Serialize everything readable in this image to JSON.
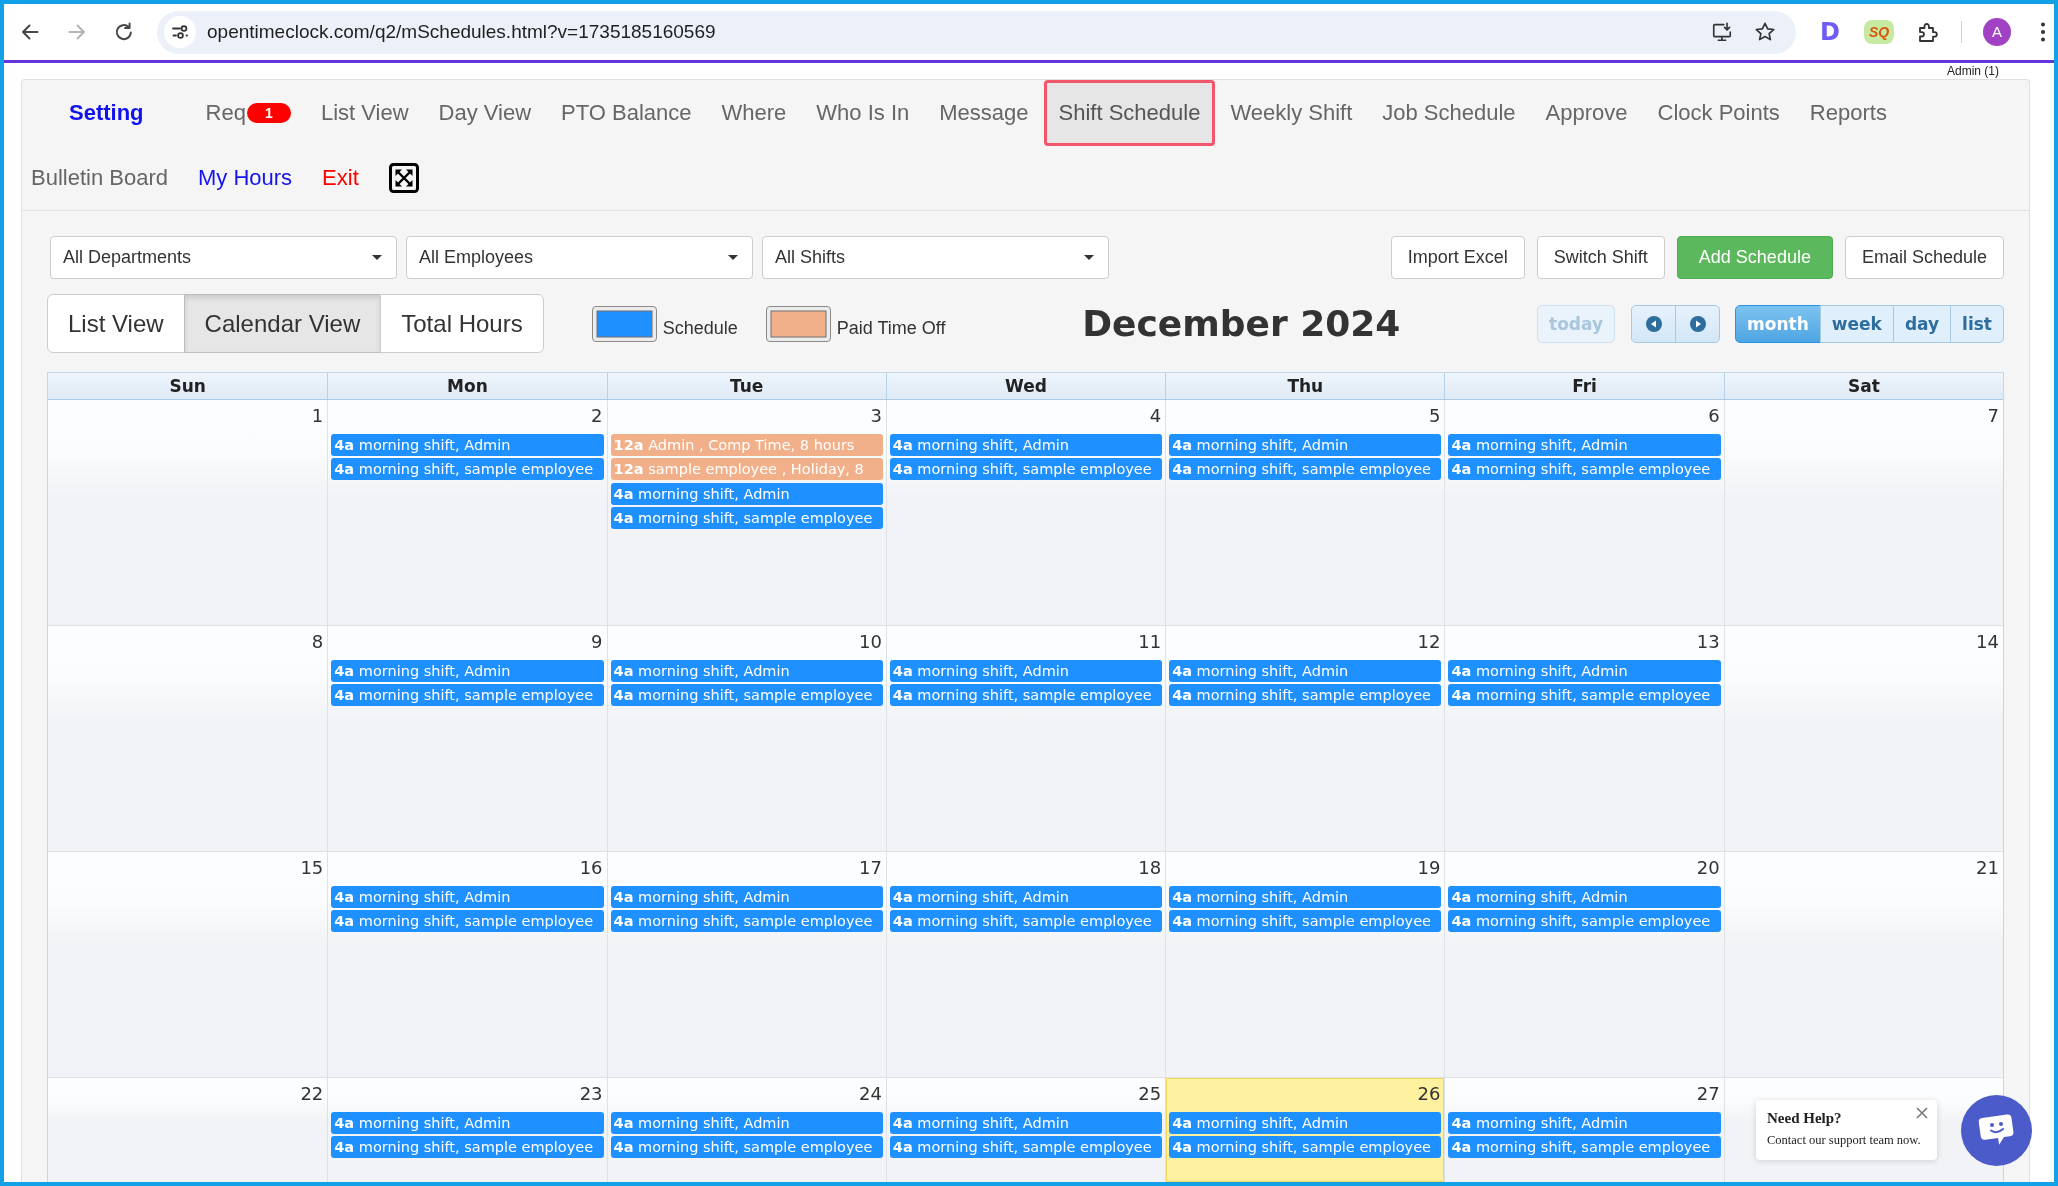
{
  "browser": {
    "nav_buttons": [
      {
        "kind": "back",
        "disabled": false
      },
      {
        "kind": "forward",
        "disabled": true
      },
      {
        "kind": "reload",
        "disabled": false
      }
    ],
    "url": "opentimeclock.com/q2/mSchedules.html?v=1735185160569",
    "extensions": [
      {
        "kind": "letter",
        "label": "D"
      },
      {
        "kind": "badge",
        "label": "SQ"
      }
    ],
    "profile_initial": "A"
  },
  "user_label": "Admin (1)",
  "nav_rows": [
    {
      "items": [
        {
          "label": "Setting",
          "kind": "primary",
          "selected": false
        },
        {
          "label": "Req",
          "kind": "plain",
          "badge": "1",
          "selected": false
        },
        {
          "label": "List View",
          "kind": "plain",
          "selected": false
        },
        {
          "label": "Day View",
          "kind": "plain",
          "selected": false
        },
        {
          "label": "PTO Balance",
          "kind": "plain",
          "selected": false
        },
        {
          "label": "Where",
          "kind": "plain",
          "selected": false
        },
        {
          "label": "Who Is In",
          "kind": "plain",
          "selected": false
        },
        {
          "label": "Message",
          "kind": "plain",
          "selected": false
        },
        {
          "label": "Shift Schedule",
          "kind": "plain",
          "selected": true
        },
        {
          "label": "Weekly Shift",
          "kind": "plain",
          "selected": false
        },
        {
          "label": "Job Schedule",
          "kind": "plain",
          "selected": false
        },
        {
          "label": "Approve",
          "kind": "plain",
          "selected": false
        },
        {
          "label": "Clock Points",
          "kind": "plain",
          "selected": false
        },
        {
          "label": "Reports",
          "kind": "plain",
          "selected": false
        }
      ]
    },
    {
      "items": [
        {
          "label": "Bulletin Board",
          "kind": "plain",
          "selected": false
        },
        {
          "label": "My Hours",
          "kind": "link",
          "selected": false
        },
        {
          "label": "Exit",
          "kind": "danger",
          "selected": false
        },
        {
          "kind": "fullscreen",
          "selected": false
        }
      ]
    }
  ],
  "filters": [
    {
      "value": "All Departments"
    },
    {
      "value": "All Employees"
    },
    {
      "value": "All Shifts"
    }
  ],
  "actions": [
    {
      "label": "Import Excel",
      "kind": "default"
    },
    {
      "label": "Switch Shift",
      "kind": "default"
    },
    {
      "label": "Add Schedule",
      "kind": "success"
    },
    {
      "label": "Email Schedule",
      "kind": "default"
    }
  ],
  "view_toggle": [
    {
      "label": "List View",
      "selected": false
    },
    {
      "label": "Calendar View",
      "selected": true
    },
    {
      "label": "Total Hours",
      "selected": false
    }
  ],
  "legend": [
    {
      "label": "Schedule",
      "color": "#1e90ff"
    },
    {
      "label": "Paid Time Off",
      "color": "#f2b08a"
    }
  ],
  "calendar": {
    "title": "December 2024",
    "today_button": {
      "label": "today",
      "disabled": true
    },
    "views": [
      {
        "label": "month",
        "selected": true
      },
      {
        "label": "week",
        "selected": false
      },
      {
        "label": "day",
        "selected": false
      },
      {
        "label": "list",
        "selected": false
      }
    ],
    "weekdays": [
      "Sun",
      "Mon",
      "Tue",
      "Wed",
      "Thu",
      "Fri",
      "Sat"
    ],
    "weeks": [
      {
        "days": [
          {
            "day": "1",
            "today": false
          },
          {
            "day": "2",
            "today": false,
            "events": [
              {
                "text": "**4a** morning shift, Admin",
                "kind": "schedule"
              },
              {
                "text": "**4a** morning shift, sample employee",
                "kind": "schedule"
              }
            ]
          },
          {
            "day": "3",
            "today": false,
            "events": [
              {
                "text": "**12a** Admin , Comp Time, 8 hours",
                "kind": "pto"
              },
              {
                "text": "**12a** sample employee , Holiday, 8",
                "kind": "pto"
              },
              {
                "text": "**4a** morning shift, Admin",
                "kind": "schedule"
              },
              {
                "text": "**4a** morning shift, sample employee",
                "kind": "schedule"
              }
            ]
          },
          {
            "day": "4",
            "today": false,
            "events": [
              {
                "text": "**4a** morning shift, Admin",
                "kind": "schedule"
              },
              {
                "text": "**4a** morning shift, sample employee",
                "kind": "schedule"
              }
            ]
          },
          {
            "day": "5",
            "today": false,
            "events": [
              {
                "text": "**4a** morning shift, Admin",
                "kind": "schedule"
              },
              {
                "text": "**4a** morning shift, sample employee",
                "kind": "schedule"
              }
            ]
          },
          {
            "day": "6",
            "today": false,
            "events": [
              {
                "text": "**4a** morning shift, Admin",
                "kind": "schedule"
              },
              {
                "text": "**4a** morning shift, sample employee",
                "kind": "schedule"
              }
            ]
          },
          {
            "day": "7",
            "today": false
          }
        ]
      },
      {
        "days": [
          {
            "day": "8",
            "today": false
          },
          {
            "day": "9",
            "today": false,
            "events": [
              {
                "text": "**4a** morning shift, Admin",
                "kind": "schedule"
              },
              {
                "text": "**4a** morning shift, sample employee",
                "kind": "schedule"
              }
            ]
          },
          {
            "day": "10",
            "today": false,
            "events": [
              {
                "text": "**4a** morning shift, Admin",
                "kind": "schedule"
              },
              {
                "text": "**4a** morning shift, sample employee",
                "kind": "schedule"
              }
            ]
          },
          {
            "day": "11",
            "today": false,
            "events": [
              {
                "text": "**4a** morning shift, Admin",
                "kind": "schedule"
              },
              {
                "text": "**4a** morning shift, sample employee",
                "kind": "schedule"
              }
            ]
          },
          {
            "day": "12",
            "today": false,
            "events": [
              {
                "text": "**4a** morning shift, Admin",
                "kind": "schedule"
              },
              {
                "text": "**4a** morning shift, sample employee",
                "kind": "schedule"
              }
            ]
          },
          {
            "day": "13",
            "today": false,
            "events": [
              {
                "text": "**4a** morning shift, Admin",
                "kind": "schedule"
              },
              {
                "text": "**4a** morning shift, sample employee",
                "kind": "schedule"
              }
            ]
          },
          {
            "day": "14",
            "today": false
          }
        ]
      },
      {
        "days": [
          {
            "day": "15",
            "today": false
          },
          {
            "day": "16",
            "today": false,
            "events": [
              {
                "text": "**4a** morning shift, Admin",
                "kind": "schedule"
              },
              {
                "text": "**4a** morning shift, sample employee",
                "kind": "schedule"
              }
            ]
          },
          {
            "day": "17",
            "today": false,
            "events": [
              {
                "text": "**4a** morning shift, Admin",
                "kind": "schedule"
              },
              {
                "text": "**4a** morning shift, sample employee",
                "kind": "schedule"
              }
            ]
          },
          {
            "day": "18",
            "today": false,
            "events": [
              {
                "text": "**4a** morning shift, Admin",
                "kind": "schedule"
              },
              {
                "text": "**4a** morning shift, sample employee",
                "kind": "schedule"
              }
            ]
          },
          {
            "day": "19",
            "today": false,
            "events": [
              {
                "text": "**4a** morning shift, Admin",
                "kind": "schedule"
              },
              {
                "text": "**4a** morning shift, sample employee",
                "kind": "schedule"
              }
            ]
          },
          {
            "day": "20",
            "today": false,
            "events": [
              {
                "text": "**4a** morning shift, Admin",
                "kind": "schedule"
              },
              {
                "text": "**4a** morning shift, sample employee",
                "kind": "schedule"
              }
            ]
          },
          {
            "day": "21",
            "today": false
          }
        ]
      },
      {
        "days": [
          {
            "day": "22",
            "today": false
          },
          {
            "day": "23",
            "today": false,
            "events": [
              {
                "text": "**4a** morning shift, Admin",
                "kind": "schedule"
              },
              {
                "text": "**4a** morning shift, sample employee",
                "kind": "schedule"
              }
            ]
          },
          {
            "day": "24",
            "today": false,
            "events": [
              {
                "text": "**4a** morning shift, Admin",
                "kind": "schedule"
              },
              {
                "text": "**4a** morning shift, sample employee",
                "kind": "schedule"
              }
            ]
          },
          {
            "day": "25",
            "today": false,
            "events": [
              {
                "text": "**4a** morning shift, Admin",
                "kind": "schedule"
              },
              {
                "text": "**4a** morning shift, sample employee",
                "kind": "schedule"
              }
            ]
          },
          {
            "day": "26",
            "today": true,
            "events": [
              {
                "text": "**4a** morning shift, Admin",
                "kind": "schedule"
              },
              {
                "text": "**4a** morning shift, sample employee",
                "kind": "schedule"
              }
            ]
          },
          {
            "day": "27",
            "today": false,
            "events": [
              {
                "text": "**4a** morning shift, Admin",
                "kind": "schedule"
              },
              {
                "text": "**4a** morning shift, sample employee",
                "kind": "schedule"
              }
            ]
          },
          {
            "today": false
          }
        ]
      }
    ]
  },
  "help_widget": {
    "title": "Need Help?",
    "text": "Contact our support team now."
  }
}
